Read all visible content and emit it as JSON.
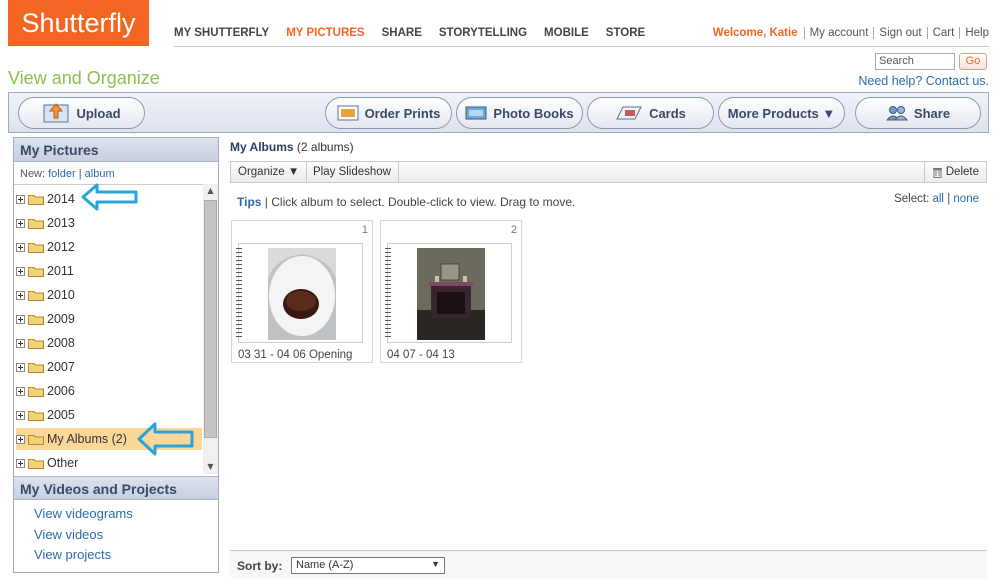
{
  "logo": {
    "text": "Shutterfly"
  },
  "nav": {
    "items": [
      {
        "label": "MY SHUTTERFLY"
      },
      {
        "label": "MY PICTURES"
      },
      {
        "label": "SHARE"
      },
      {
        "label": "STORYTELLING"
      },
      {
        "label": "MOBILE"
      },
      {
        "label": "STORE"
      }
    ]
  },
  "user": {
    "welcome": "Welcome, Katie",
    "links": [
      "My account",
      "Sign out",
      "Cart",
      "Help"
    ]
  },
  "search": {
    "placeholder": "Search",
    "go_label": "Go"
  },
  "help": {
    "text": "Need help? Contact us."
  },
  "page": {
    "title": "View and Organize"
  },
  "toolbar": {
    "upload": "Upload",
    "order_prints": "Order Prints",
    "photo_books": "Photo Books",
    "cards": "Cards",
    "more_products": "More Products ▼",
    "share": "Share"
  },
  "left": {
    "heading": "My Pictures",
    "new_label": "New:",
    "new_folder": "folder",
    "new_sep": "|",
    "new_album": "album",
    "tree": [
      {
        "label": "2014"
      },
      {
        "label": "2013"
      },
      {
        "label": "2012"
      },
      {
        "label": "2011"
      },
      {
        "label": "2010"
      },
      {
        "label": "2009"
      },
      {
        "label": "2008"
      },
      {
        "label": "2007"
      },
      {
        "label": "2006"
      },
      {
        "label": "2005"
      },
      {
        "label": "My Albums (2)"
      },
      {
        "label": "Other"
      }
    ],
    "videos_heading": "My Videos and Projects",
    "video_links": [
      "View videograms",
      "View videos",
      "View projects"
    ]
  },
  "main": {
    "title": "My Albums",
    "count": "(2 albums)",
    "actions": {
      "organize": "Organize ▼",
      "slideshow": "Play Slideshow",
      "delete": "Delete"
    },
    "tips_label": "Tips",
    "tips_text": "| Click album to select. Double-click to view. Drag to move.",
    "select_label": "Select:",
    "select_all": "all",
    "select_sep": "|",
    "select_none": "none",
    "albums": [
      {
        "number": "1",
        "caption": "03 31 - 04 06 Opening"
      },
      {
        "number": "2",
        "caption": "04 07 - 04 13"
      }
    ],
    "sort_label": "Sort by:",
    "sort_value": "Name (A-Z)"
  },
  "colors": {
    "brand": "#f26522",
    "title_green": "#8bc34a",
    "link_blue": "#2b6ca8",
    "selected": "#fbd79a",
    "arrow": "#29a3dc"
  }
}
